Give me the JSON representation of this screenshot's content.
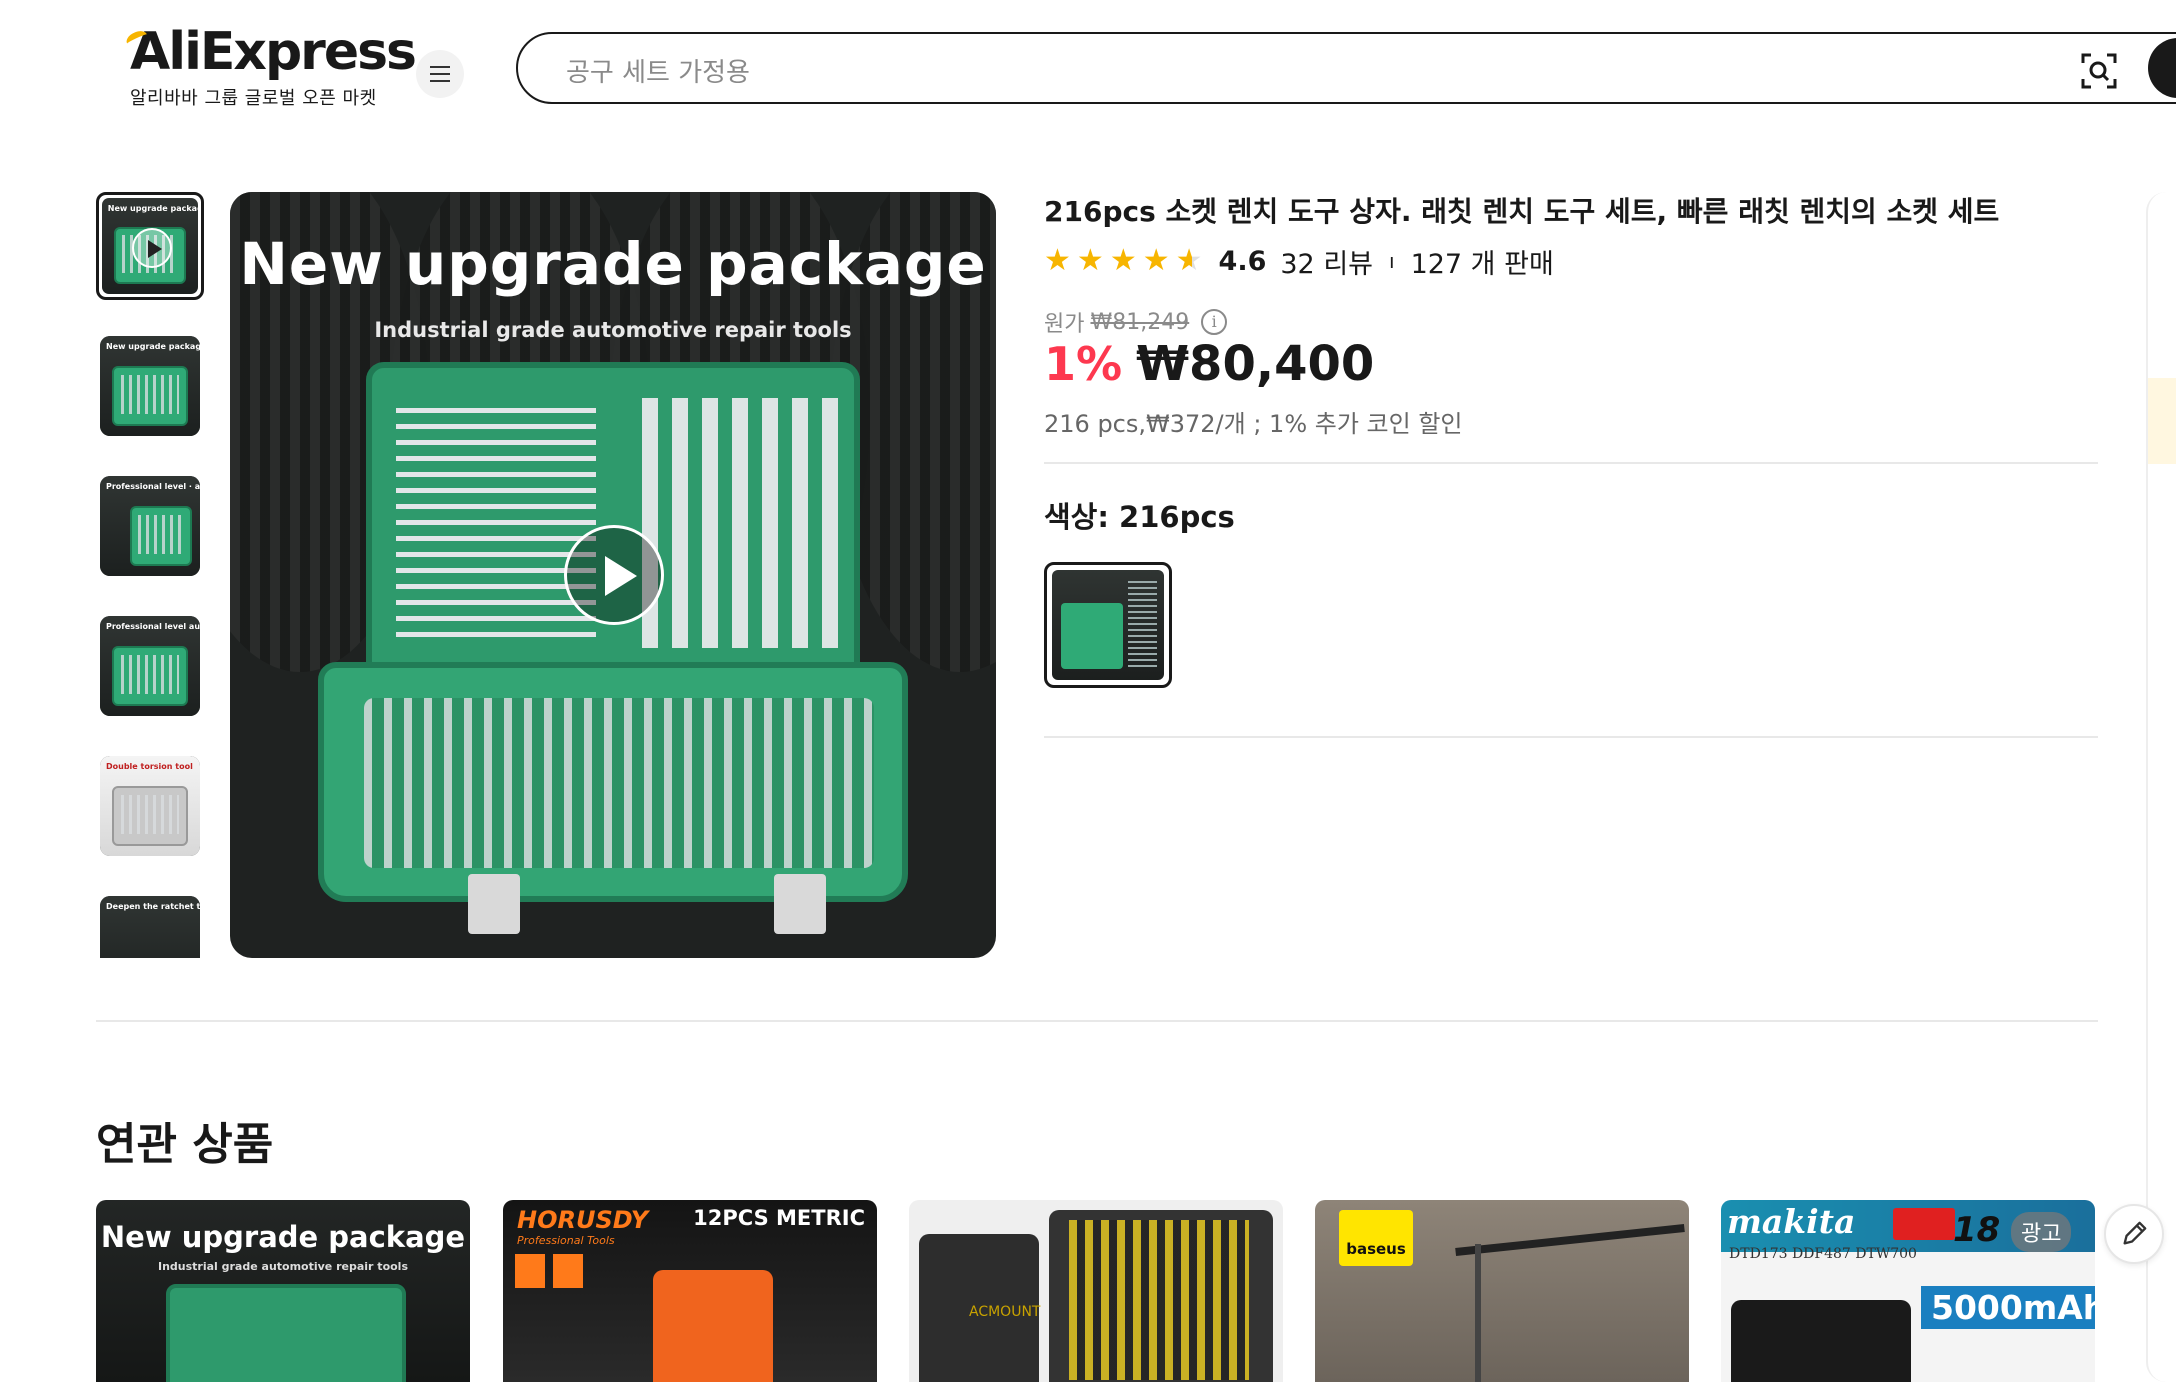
{
  "header": {
    "logo_text": "AliExpress",
    "logo_subtitle": "알리바바 그룹 글로벌 오픈 마켓",
    "search_placeholder": "공구 세트 가정용"
  },
  "gallery": {
    "main_title": "New upgrade package",
    "main_subtitle": "Industrial grade automotive repair tools",
    "thumbnails": [
      {
        "caption": "New upgrade package"
      },
      {
        "caption": "New upgrade package"
      },
      {
        "caption": "Professional level · auto repair set"
      },
      {
        "caption": "Professional level auto repair kit"
      },
      {
        "caption": "Double torsion tool"
      },
      {
        "caption": "Deepen the ratchet teeth"
      }
    ]
  },
  "product": {
    "title": "216pcs 소켓 렌치 도구 상자. 래칫 렌치 도구 세트, 빠른 래칫 렌치의 소켓 세트",
    "rating": "4.6",
    "reviews": "32 리뷰",
    "separator": "ı",
    "sold": "127 개 판매",
    "original_label": "원가",
    "original_price": "₩81,249",
    "discount": "1%",
    "price": "₩80,400",
    "unit_info": "216 pcs,₩372/개 ; 1% 추가 코인 할인",
    "color_label": "색상: 216pcs",
    "star_count": 4.6
  },
  "related": {
    "title": "연관 상품",
    "cards": [
      {
        "title": "New upgrade package",
        "subtitle": "Industrial grade automotive repair tools"
      },
      {
        "brand": "HORUSDY",
        "brand_sub": "Professional Tools",
        "badge": "12PCS METRIC"
      },
      {
        "label": "ACMOUNT"
      },
      {
        "brand": "baseus"
      },
      {
        "brand": "makita",
        "models": "DTD173  DDF487  DTW700",
        "voltage": "18",
        "ad": "광고",
        "capacity": "5000mAh"
      }
    ]
  },
  "colors": {
    "accent_red": "#fd384f",
    "star_gold": "#f7b500",
    "text_dark": "#191919"
  }
}
